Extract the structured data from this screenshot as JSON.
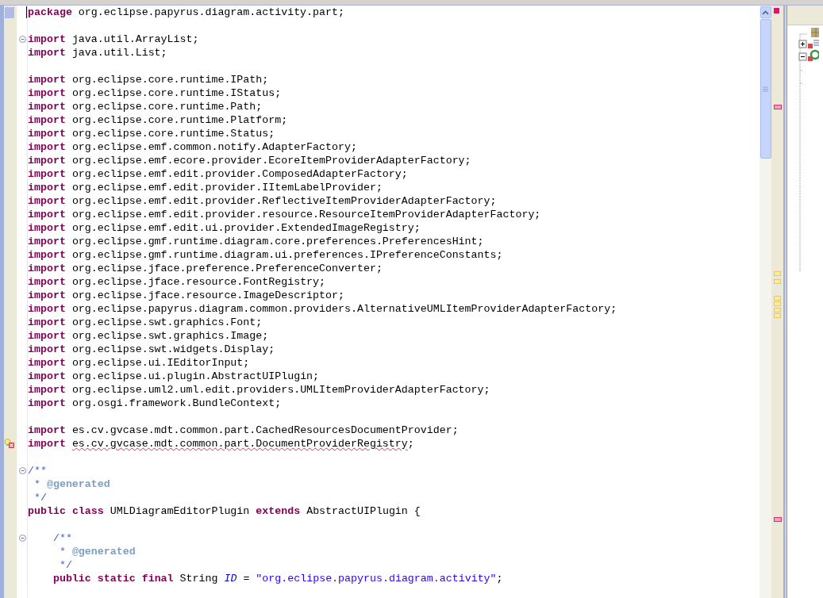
{
  "editor": {
    "lines": [
      {
        "ruler_marker": {
          "kind": "range"
        },
        "tokens": [
          {
            "kind": "keyword",
            "text": "package"
          },
          {
            "kind": "plain",
            "text": " org.eclipse.papyrus.diagram.activity.part;"
          }
        ]
      },
      {
        "kind": "blank"
      },
      {
        "expanded": true,
        "tokens": [
          {
            "kind": "keyword",
            "text": "import"
          },
          {
            "kind": "plain",
            "text": " java.util.ArrayList;"
          }
        ]
      },
      {
        "tokens": [
          {
            "kind": "keyword",
            "text": "import"
          },
          {
            "kind": "plain",
            "text": " java.util.List;"
          }
        ]
      },
      {
        "kind": "blank"
      },
      {
        "tokens": [
          {
            "kind": "keyword",
            "text": "import"
          },
          {
            "kind": "plain",
            "text": " org.eclipse.core.runtime.IPath;"
          }
        ]
      },
      {
        "tokens": [
          {
            "kind": "keyword",
            "text": "import"
          },
          {
            "kind": "plain",
            "text": " org.eclipse.core.runtime.IStatus;"
          }
        ]
      },
      {
        "tokens": [
          {
            "kind": "keyword",
            "text": "import"
          },
          {
            "kind": "plain",
            "text": " org.eclipse.core.runtime.Path;"
          }
        ]
      },
      {
        "tokens": [
          {
            "kind": "keyword",
            "text": "import"
          },
          {
            "kind": "plain",
            "text": " org.eclipse.core.runtime.Platform;"
          }
        ]
      },
      {
        "tokens": [
          {
            "kind": "keyword",
            "text": "import"
          },
          {
            "kind": "plain",
            "text": " org.eclipse.core.runtime.Status;"
          }
        ]
      },
      {
        "tokens": [
          {
            "kind": "keyword",
            "text": "import"
          },
          {
            "kind": "plain",
            "text": " org.eclipse.emf.common.notify.AdapterFactory;"
          }
        ]
      },
      {
        "tokens": [
          {
            "kind": "keyword",
            "text": "import"
          },
          {
            "kind": "plain",
            "text": " org.eclipse.emf.ecore.provider.EcoreItemProviderAdapterFactory;"
          }
        ]
      },
      {
        "tokens": [
          {
            "kind": "keyword",
            "text": "import"
          },
          {
            "kind": "plain",
            "text": " org.eclipse.emf.edit.provider.ComposedAdapterFactory;"
          }
        ]
      },
      {
        "tokens": [
          {
            "kind": "keyword",
            "text": "import"
          },
          {
            "kind": "plain",
            "text": " org.eclipse.emf.edit.provider.IItemLabelProvider;"
          }
        ]
      },
      {
        "tokens": [
          {
            "kind": "keyword",
            "text": "import"
          },
          {
            "kind": "plain",
            "text": " org.eclipse.emf.edit.provider.ReflectiveItemProviderAdapterFactory;"
          }
        ]
      },
      {
        "tokens": [
          {
            "kind": "keyword",
            "text": "import"
          },
          {
            "kind": "plain",
            "text": " org.eclipse.emf.edit.provider.resource.ResourceItemProviderAdapterFactory;"
          }
        ]
      },
      {
        "tokens": [
          {
            "kind": "keyword",
            "text": "import"
          },
          {
            "kind": "plain",
            "text": " org.eclipse.emf.edit.ui.provider.ExtendedImageRegistry;"
          }
        ]
      },
      {
        "tokens": [
          {
            "kind": "keyword",
            "text": "import"
          },
          {
            "kind": "plain",
            "text": " org.eclipse.gmf.runtime.diagram.core.preferences.PreferencesHint;"
          }
        ]
      },
      {
        "tokens": [
          {
            "kind": "keyword",
            "text": "import"
          },
          {
            "kind": "plain",
            "text": " org.eclipse.gmf.runtime.diagram.ui.preferences.IPreferenceConstants;"
          }
        ]
      },
      {
        "tokens": [
          {
            "kind": "keyword",
            "text": "import"
          },
          {
            "kind": "plain",
            "text": " org.eclipse.jface.preference.PreferenceConverter;"
          }
        ]
      },
      {
        "tokens": [
          {
            "kind": "keyword",
            "text": "import"
          },
          {
            "kind": "plain",
            "text": " org.eclipse.jface.resource.FontRegistry;"
          }
        ]
      },
      {
        "tokens": [
          {
            "kind": "keyword",
            "text": "import"
          },
          {
            "kind": "plain",
            "text": " org.eclipse.jface.resource.ImageDescriptor;"
          }
        ]
      },
      {
        "tokens": [
          {
            "kind": "keyword",
            "text": "import"
          },
          {
            "kind": "plain",
            "text": " org.eclipse.papyrus.diagram.common.providers.AlternativeUMLItemProviderAdapterFactory;"
          }
        ]
      },
      {
        "tokens": [
          {
            "kind": "keyword",
            "text": "import"
          },
          {
            "kind": "plain",
            "text": " org.eclipse.swt.graphics.Font;"
          }
        ]
      },
      {
        "tokens": [
          {
            "kind": "keyword",
            "text": "import"
          },
          {
            "kind": "plain",
            "text": " org.eclipse.swt.graphics.Image;"
          }
        ]
      },
      {
        "tokens": [
          {
            "kind": "keyword",
            "text": "import"
          },
          {
            "kind": "plain",
            "text": " org.eclipse.swt.widgets.Display;"
          }
        ]
      },
      {
        "tokens": [
          {
            "kind": "keyword",
            "text": "import"
          },
          {
            "kind": "plain",
            "text": " org.eclipse.ui.IEditorInput;"
          }
        ]
      },
      {
        "tokens": [
          {
            "kind": "keyword",
            "text": "import"
          },
          {
            "kind": "plain",
            "text": " org.eclipse.ui.plugin.AbstractUIPlugin;"
          }
        ]
      },
      {
        "tokens": [
          {
            "kind": "keyword",
            "text": "import"
          },
          {
            "kind": "plain",
            "text": " org.eclipse.uml2.uml.edit.providers.UMLItemProviderAdapterFactory;"
          }
        ]
      },
      {
        "tokens": [
          {
            "kind": "keyword",
            "text": "import"
          },
          {
            "kind": "plain",
            "text": " org.osgi.framework.BundleContext;"
          }
        ]
      },
      {
        "kind": "blank"
      },
      {
        "tokens": [
          {
            "kind": "keyword",
            "text": "import"
          },
          {
            "kind": "plain",
            "text": " es.cv.gvcase.mdt.common.part.CachedResourcesDocumentProvider;"
          }
        ]
      },
      {
        "ruler_marker": {
          "kind": "error"
        },
        "tokens": [
          {
            "kind": "keyword",
            "text": "import"
          },
          {
            "kind": "error",
            "text": " es.cv.gvcase.mdt.common.part.DocumentProviderRegistry"
          },
          {
            "kind": "plain",
            "text": ";"
          }
        ]
      },
      {
        "kind": "blank"
      },
      {
        "expanded": true,
        "tokens": [
          {
            "kind": "comment",
            "text": "/**"
          }
        ]
      },
      {
        "tokens": [
          {
            "kind": "comment",
            "text": " *"
          },
          {
            "kind": "doctag",
            "text": " @generated"
          }
        ]
      },
      {
        "tokens": [
          {
            "kind": "comment",
            "text": " */"
          }
        ]
      },
      {
        "tokens": [
          {
            "kind": "keyword",
            "text": "public"
          },
          {
            "kind": "keyword",
            "text": " class"
          },
          {
            "kind": "plain",
            "text": " UMLDiagramEditorPlugin"
          },
          {
            "kind": "keyword",
            "text": " extends"
          },
          {
            "kind": "plain",
            "text": " AbstractUIPlugin {"
          }
        ]
      },
      {
        "kind": "blank"
      },
      {
        "expanded": true,
        "tokens": [
          {
            "kind": "comment",
            "text": "    /**"
          }
        ]
      },
      {
        "tokens": [
          {
            "kind": "comment",
            "text": "     *"
          },
          {
            "kind": "doctag",
            "text": " @generated"
          }
        ]
      },
      {
        "tokens": [
          {
            "kind": "comment",
            "text": "     */"
          }
        ]
      },
      {
        "tokens": [
          {
            "kind": "keyword",
            "text": "    public"
          },
          {
            "kind": "keyword",
            "text": " static"
          },
          {
            "kind": "keyword",
            "text": " final"
          },
          {
            "kind": "plain",
            "text": " String"
          },
          {
            "kind": "field",
            "text": " ID"
          },
          {
            "kind": "plain",
            "text": " ="
          },
          {
            "kind": "string",
            "text": " \"org.eclipse.papyrus.diagram.activity\""
          },
          {
            "kind": "plain",
            "text": ";"
          }
        ]
      },
      {
        "kind": "blank"
      }
    ]
  }
}
